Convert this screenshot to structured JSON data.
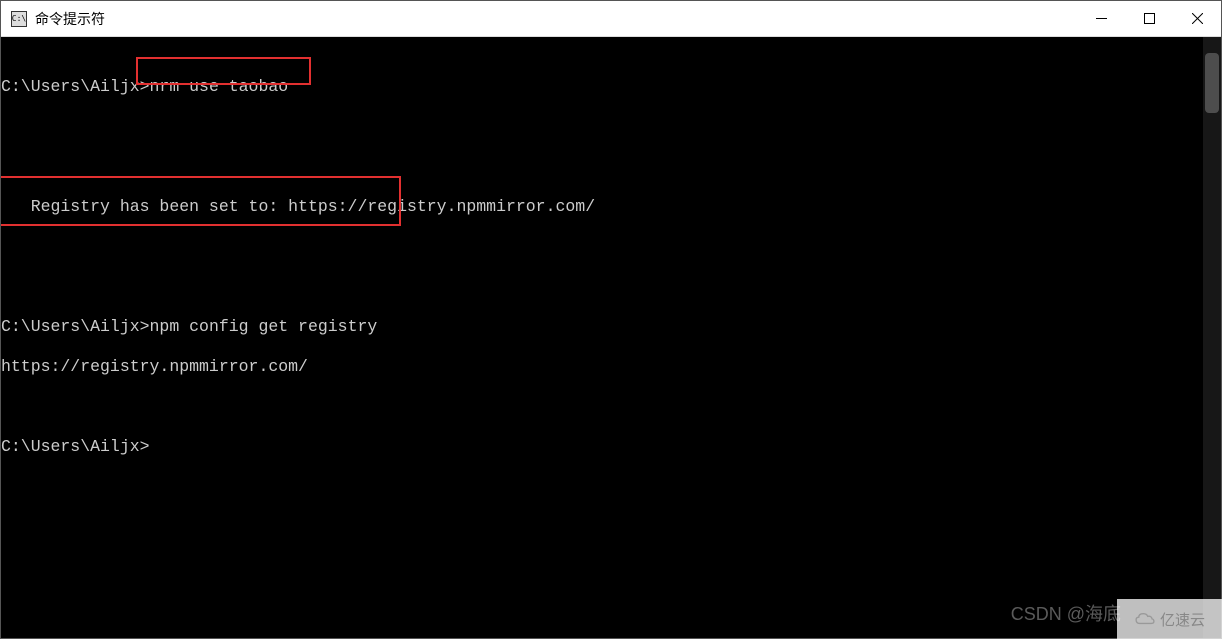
{
  "titlebar": {
    "icon_text": "C:\\",
    "title": "命令提示符"
  },
  "terminal": {
    "lines": [
      {
        "prompt": "C:\\Users\\Ailjx>",
        "command": "nrm use taobao"
      },
      {
        "text": ""
      },
      {
        "text": ""
      },
      {
        "text": "   Registry has been set to: https://registry.npmmirror.com/"
      },
      {
        "text": ""
      },
      {
        "text": ""
      },
      {
        "prompt": "C:\\Users\\Ailjx>",
        "command": "npm config get registry"
      },
      {
        "text": "https://registry.npmmirror.com/"
      },
      {
        "text": ""
      },
      {
        "prompt": "C:\\Users\\Ailjx>",
        "command": ""
      }
    ]
  },
  "watermarks": {
    "csdn": "CSDN @海底",
    "yisu": "亿速云"
  }
}
